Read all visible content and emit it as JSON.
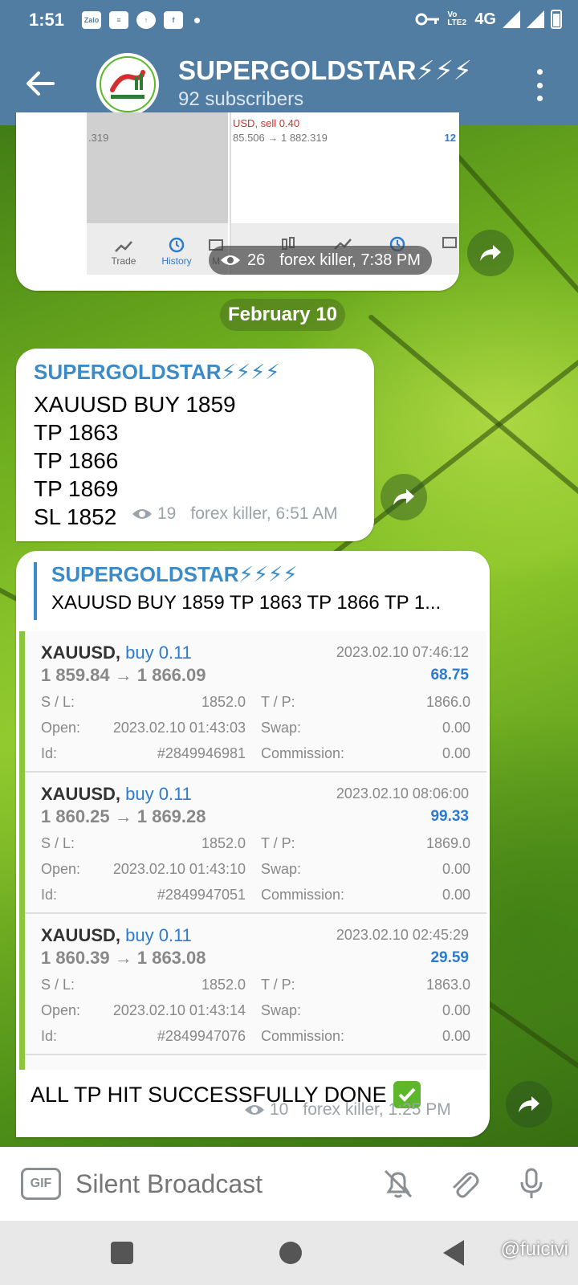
{
  "status_bar": {
    "time": "1:51",
    "network": "4G",
    "volte": "Vo LTE2",
    "left_icons": [
      "zalo-icon",
      "news-icon",
      "upload-icon",
      "facebook-icon",
      "dot-icon"
    ]
  },
  "header": {
    "title": "SUPERGOLDSTAR⚡⚡⚡",
    "subtitle": "92 subscribers"
  },
  "image_message": {
    "views": "26",
    "meta": "forex killer, 7:38 PM",
    "left_partial_text": ".319",
    "right_partial_text": "85.506 → 1 882.319",
    "right_partial_profit": "12",
    "right_partial_head": "USD, sell 0.40",
    "nav_items": [
      "Trade",
      "History",
      "M"
    ]
  },
  "date_separator": "February 10",
  "signal_message": {
    "author": "SUPERGOLDSTAR⚡⚡⚡⚡",
    "lines": [
      "XAUUSD BUY 1859",
      "TP 1863",
      "TP 1866",
      "TP 1869",
      "SL 1852"
    ],
    "views": "19",
    "meta": "forex killer, 6:51 AM"
  },
  "result_message": {
    "reply_author": "SUPERGOLDSTAR⚡⚡⚡⚡",
    "reply_text": "XAUUSD BUY 1859 TP 1863 TP 1866 TP 1...",
    "trades": [
      {
        "symbol": "XAUUSD,",
        "side": "buy 0.11",
        "date": "2023.02.10 07:46:12",
        "price": "1 859.84 → 1 866.09",
        "profit": "68.75",
        "sl_label": "S / L:",
        "sl": "1852.0",
        "tp_label": "T / P:",
        "tp": "1866.0",
        "open_label": "Open:",
        "open": "2023.02.10 01:43:03",
        "swap_label": "Swap:",
        "swap": "0.00",
        "id_label": "Id:",
        "id": "#2849946981",
        "commission_label": "Commission:",
        "commission": "0.00"
      },
      {
        "symbol": "XAUUSD,",
        "side": "buy 0.11",
        "date": "2023.02.10 08:06:00",
        "price": "1 860.25 → 1 869.28",
        "profit": "99.33",
        "sl_label": "S / L:",
        "sl": "1852.0",
        "tp_label": "T / P:",
        "tp": "1869.0",
        "open_label": "Open:",
        "open": "2023.02.10 01:43:10",
        "swap_label": "Swap:",
        "swap": "0.00",
        "id_label": "Id:",
        "id": "#2849947051",
        "commission_label": "Commission:",
        "commission": "0.00"
      },
      {
        "symbol": "XAUUSD,",
        "side": "buy 0.11",
        "date": "2023.02.10 02:45:29",
        "price": "1 860.39 → 1 863.08",
        "profit": "29.59",
        "sl_label": "S / L:",
        "sl": "1852.0",
        "tp_label": "T / P:",
        "tp": "1863.0",
        "open_label": "Open:",
        "open": "2023.02.10 01:43:14",
        "swap_label": "Swap:",
        "swap": "0.00",
        "id_label": "Id:",
        "id": "#2849947076",
        "commission_label": "Commission:",
        "commission": "0.00"
      }
    ],
    "caption": "ALL TP HIT SUCCESSFULLY DONE",
    "views": "10",
    "meta": "forex killer, 1:25 PM"
  },
  "input_bar": {
    "gif_label": "GIF",
    "placeholder": "Silent Broadcast"
  },
  "watermark": "@fuicivi",
  "colors": {
    "header_bg": "#517da2",
    "link_blue": "#3a8bc8",
    "profit_blue": "#2c7bd1",
    "accent_green": "#8cc63f"
  }
}
